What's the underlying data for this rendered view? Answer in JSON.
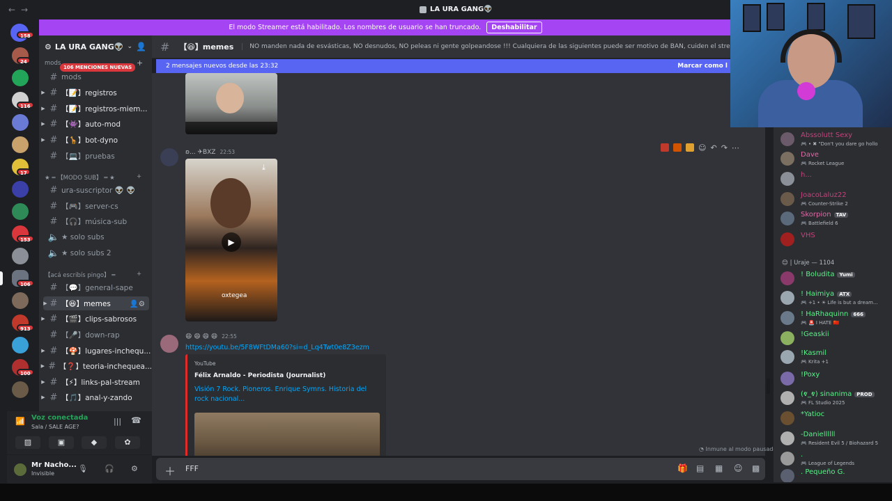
{
  "titlebar": {
    "back": "←",
    "forward": "→",
    "title": "LA URA GANG👽"
  },
  "banner": {
    "text": "El modo Streamer está habilitado. Los nombres de usuario se han truncado.",
    "button": "Deshabilitar"
  },
  "guild_badges": [
    "158",
    "24",
    "116",
    "17",
    "153",
    "106",
    "913",
    "100"
  ],
  "server": {
    "name": "LA URA GANG👽",
    "mentions": "106 MENCIONES NUEVAS"
  },
  "channels": {
    "mods": "mods",
    "registros": "【📝】registros",
    "registros_miem": "【📝】registros-miem...",
    "automod": "【👾】auto-mod",
    "botdyno": "【🦒】bot-dyno",
    "pruebas": "【💻】pruebas",
    "cat_modo_sub": "★ ═ 【MODO SUB】 ═ ★",
    "ura_suscriptor": "ura-suscriptor 👽 👽",
    "server_cs": "【🎮】server-cs",
    "musica_sub": "【🎧】música-sub",
    "solo_subs": "★ solo subs",
    "solo_subs2": "★ solo subs 2",
    "cat_aca": "【acá escribís pingo】 ═",
    "general_sape": "【💬】general-sape",
    "memes": "【😆】memes",
    "clips": "【🎬】clips-sabrosos",
    "down_rap": "【🎤】down-rap",
    "lugares": "【🍄】lugares-inchequ...",
    "teoria": "【❓】teoria-inchequea...",
    "links": "【⚡】links-pal-stream",
    "anal": "【🎵】anal-y-zando"
  },
  "voice": {
    "status": "Voz conectada",
    "sub": "Sala / SALE AGE?"
  },
  "user": {
    "name": "Mr Nacho...",
    "status": "Invisible"
  },
  "channel_header": {
    "name": "【😆】memes",
    "topic": "NO manden nada de esvásticas, NO desnudos, NO peleas ni gente golpeandose !!! Cualquiera de las siguientes puede ser motivo de BAN, cuiden el stream!"
  },
  "new_messages": {
    "text": "2 mensajes nuevos desde las 23:32",
    "mark": "Marcar como l"
  },
  "messages": {
    "msg1": {
      "name": "ʚ... ✈BXZ",
      "time": "22:53",
      "watermark": "oxtegea"
    },
    "msg2": {
      "name": "😄 😄 😄 😄",
      "time": "22:55",
      "link": "https://youtu.be/5F8WFtDMa60?si=d_Lq4Twt0e8Z3ezm",
      "embed": {
        "provider": "YouTube",
        "author": "Félix Arnaldo - Periodista (Journalist)",
        "title": "Visión 7 Rock. Pioneros. Enrique Symns. Historia del rock nacional..."
      }
    }
  },
  "immune": "Inmune al modo pausado",
  "composer": {
    "text": "FFF"
  },
  "members": [
    {
      "name": "Abssolutt Sexy",
      "activity": "🎮 • ✖ \"Don't you dare go hollo",
      "color": "#c1447c"
    },
    {
      "name": "Dave",
      "activity": "🎮 Rocket League",
      "color": "#e06aa7"
    },
    {
      "name": "h...",
      "activity": "",
      "color": "#c1447c"
    },
    {
      "name": "JoacoLaluz22",
      "activity": "🎮 Counter-Strike 2",
      "color": "#c1447c"
    },
    {
      "name": "Skorpion",
      "tag": "TAV",
      "activity": "🎮 Battlefield 6",
      "color": "#e06aa7"
    },
    {
      "name": "VHS",
      "activity": "",
      "color": "#c1447c"
    }
  ],
  "role_header": "😊 | Uraje — 1104",
  "members2": [
    {
      "name": "! Boludita",
      "tag": "Yumi",
      "activity": "",
      "color": "#57f287"
    },
    {
      "name": "! Haimiya",
      "tag": "ATX",
      "activity": "🎮 +1 • ☀ Life is but a dream...",
      "color": "#57f287"
    },
    {
      "name": "! HaRhaquinn",
      "tag": "666",
      "activity": "🎮 🚨 I HATE 🇨🇳",
      "color": "#57f287"
    },
    {
      "name": "!Geaskii",
      "activity": "",
      "color": "#57f287"
    },
    {
      "name": "!Kasmil",
      "activity": "🎮 Krita +1",
      "color": "#57f287"
    },
    {
      "name": "!Poxy",
      "activity": "",
      "color": "#57f287"
    },
    {
      "name": "(ⱴ_ⱴ) sinanima",
      "tag": "PROD",
      "activity": "🎮 FL Studio 2025",
      "color": "#57f287"
    },
    {
      "name": "*Yatioc",
      "activity": "",
      "color": "#57f287"
    },
    {
      "name": "-Daniellllll",
      "activity": "🎮 Resident Evil 5 / Biohazard 5",
      "color": "#57f287"
    },
    {
      "name": ".",
      "activity": "🎮 League of Legends",
      "color": "#57f287"
    },
    {
      "name": ". Pequeño G.",
      "activity": "",
      "color": "#57f287"
    }
  ]
}
